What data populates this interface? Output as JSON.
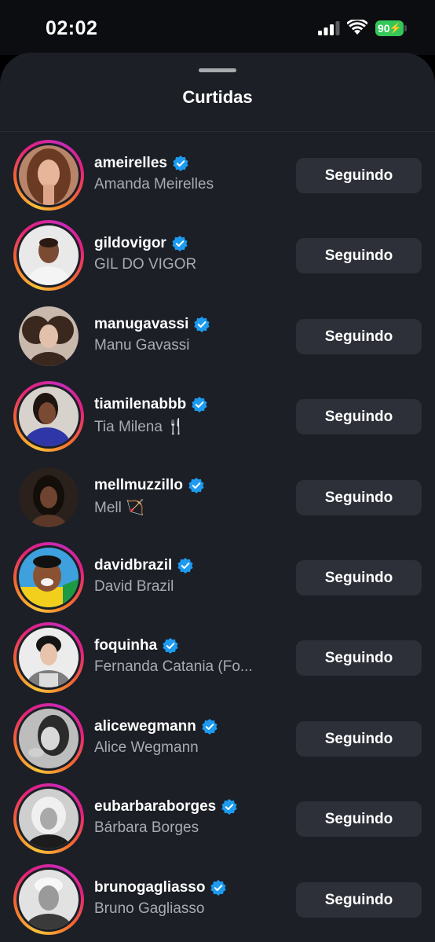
{
  "status_bar": {
    "time": "02:02",
    "battery": "90",
    "icons": [
      "signal-icon",
      "wifi-icon",
      "battery-charging-icon"
    ]
  },
  "sheet": {
    "title": "Curtidas"
  },
  "colors": {
    "sheet_background": "#1c1f26",
    "button_background": "#2d3038",
    "verified_blue": "#1d9bf0",
    "secondary_text": "#a8abb1",
    "battery_green": "#34c759"
  },
  "users": [
    {
      "username": "ameirelles",
      "full_name": "Amanda Meirelles",
      "button": "Seguindo",
      "verified": true,
      "story_ring": true
    },
    {
      "username": "gildovigor",
      "full_name": "GIL DO VIGOR",
      "button": "Seguindo",
      "verified": true,
      "story_ring": true
    },
    {
      "username": "manugavassi",
      "full_name": "Manu Gavassi",
      "button": "Seguindo",
      "verified": true,
      "story_ring": false
    },
    {
      "username": "tiamilenabbb",
      "full_name": "Tia Milena 🍴",
      "button": "Seguindo",
      "verified": true,
      "story_ring": true
    },
    {
      "username": "mellmuzzillo",
      "full_name": "Mell 🏹",
      "button": "Seguindo",
      "verified": true,
      "story_ring": false
    },
    {
      "username": "davidbrazil",
      "full_name": "David Brazil",
      "button": "Seguindo",
      "verified": true,
      "story_ring": true
    },
    {
      "username": "foquinha",
      "full_name": "Fernanda Catania (Fo...",
      "button": "Seguindo",
      "verified": true,
      "story_ring": true
    },
    {
      "username": "alicewegmann",
      "full_name": "Alice Wegmann",
      "button": "Seguindo",
      "verified": true,
      "story_ring": true
    },
    {
      "username": "eubarbaraborges",
      "full_name": "Bárbara Borges",
      "button": "Seguindo",
      "verified": true,
      "story_ring": true
    },
    {
      "username": "brunogagliasso",
      "full_name": "Bruno Gagliasso",
      "button": "Seguindo",
      "verified": true,
      "story_ring": true
    }
  ]
}
